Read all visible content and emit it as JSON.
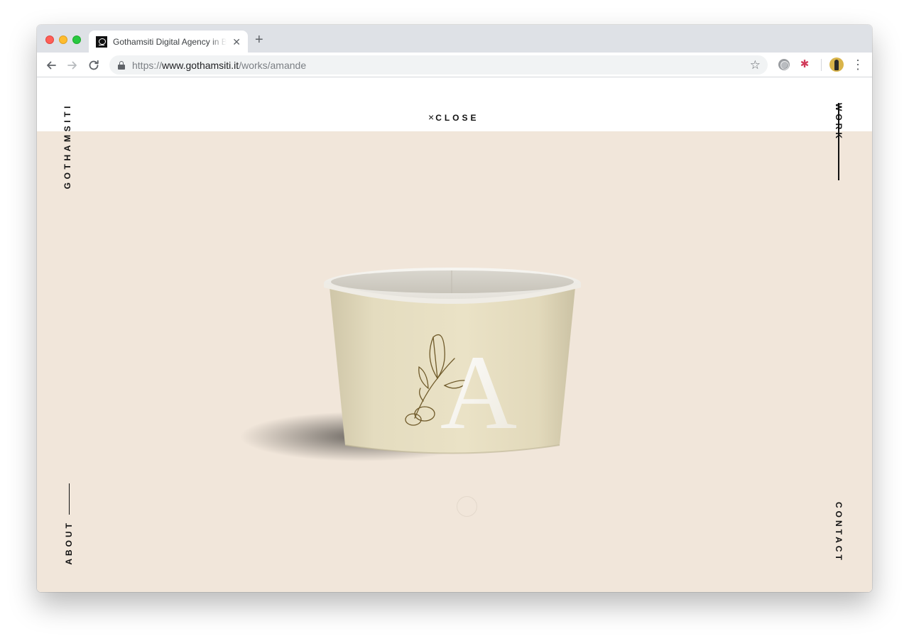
{
  "browser": {
    "tab": {
      "title": "Gothamsiti Digital Agency in Br",
      "close_glyph": "✕"
    },
    "new_tab_glyph": "+",
    "url": {
      "scheme": "https://",
      "host": "www.gothamsiti.it",
      "path": "/works/amande"
    },
    "icons": {
      "back": "arrow-left-icon",
      "forward": "arrow-right-icon",
      "reload": "reload-icon",
      "lock": "lock-icon",
      "star": "star-icon",
      "menu": "kebab-menu-icon"
    },
    "star_glyph": "☆",
    "menu_glyph": "⋮",
    "extension_glyph": "✱"
  },
  "site": {
    "logo": "GOTHAMSITI",
    "close": {
      "icon": "×",
      "label": "CLOSE"
    },
    "nav": {
      "work": "WORK",
      "about": "ABOUT",
      "contact": "CONTACT"
    }
  },
  "hero": {
    "product_monogram": "A",
    "background_color": "#f1e6da"
  }
}
